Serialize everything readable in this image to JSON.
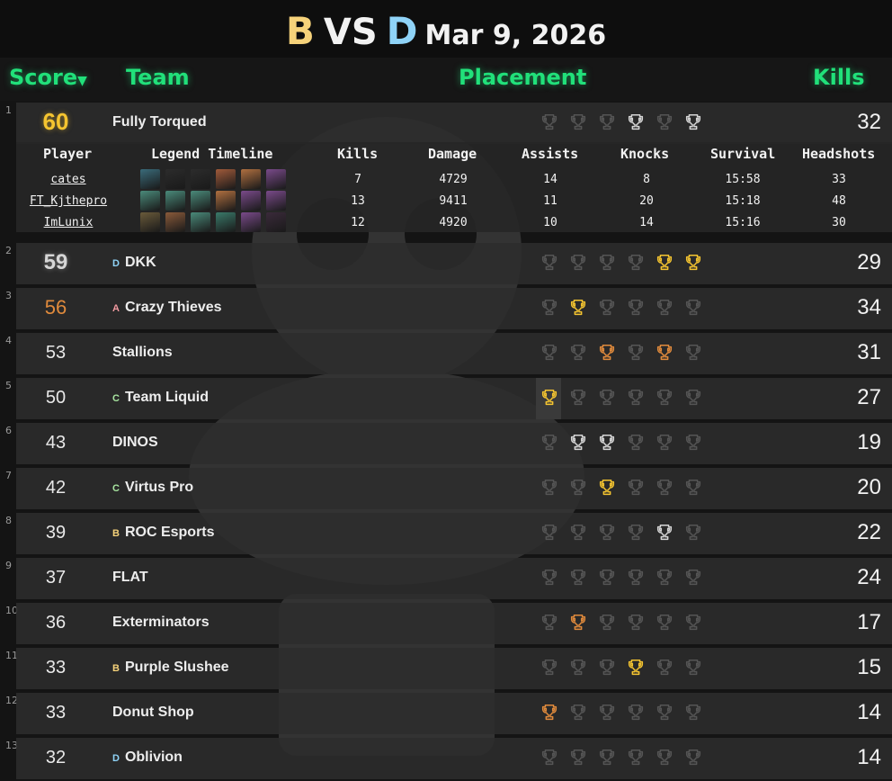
{
  "title": {
    "team_a": "B",
    "vs": "VS",
    "team_b": "D",
    "date": "Mar 9, 2026"
  },
  "header": {
    "score": "Score",
    "score_sort_icon": "caret-down-icon",
    "team": "Team",
    "placement": "Placement",
    "kills": "Kills"
  },
  "colors": {
    "accent": "#21e07a",
    "gold": "#f4c430",
    "silver": "#d6d6d6",
    "bronze": "#e08a3c",
    "trophy_dim": "#555555"
  },
  "details": {
    "headers": [
      "Player",
      "Legend Timeline",
      "Kills",
      "Damage",
      "Assists",
      "Knocks",
      "Survival",
      "Headshots"
    ],
    "players": [
      {
        "name": "cates",
        "kills": "7",
        "damage": "4729",
        "assists": "14",
        "knocks": "8",
        "survival": "15:58",
        "headshots": "33"
      },
      {
        "name": "FT_Kjthepro",
        "kills": "13",
        "damage": "9411",
        "assists": "11",
        "knocks": "20",
        "survival": "15:18",
        "headshots": "48"
      },
      {
        "name": "ImLunix",
        "kills": "12",
        "damage": "4920",
        "assists": "10",
        "knocks": "14",
        "survival": "15:16",
        "headshots": "30"
      }
    ]
  },
  "rows": [
    {
      "rank": "1",
      "score": "60",
      "group": "",
      "team": "Fully Torqued",
      "kills": "32",
      "placements": [
        "dim",
        "dim",
        "dim",
        "silver",
        "dim",
        "silver"
      ]
    },
    {
      "rank": "2",
      "score": "59",
      "group": "D",
      "team": "DKK",
      "kills": "29",
      "placements": [
        "dim",
        "dim",
        "dim",
        "dim",
        "gold",
        "gold"
      ]
    },
    {
      "rank": "3",
      "score": "56",
      "group": "A",
      "team": "Crazy Thieves",
      "kills": "34",
      "placements": [
        "dim",
        "gold",
        "dim",
        "dim",
        "dim",
        "dim"
      ]
    },
    {
      "rank": "4",
      "score": "53",
      "group": "",
      "team": "Stallions",
      "kills": "31",
      "placements": [
        "dim",
        "dim",
        "bronze",
        "dim",
        "bronze",
        "dim"
      ]
    },
    {
      "rank": "5",
      "score": "50",
      "group": "C",
      "team": "Team Liquid",
      "kills": "27",
      "placements": [
        "win",
        "dim",
        "dim",
        "dim",
        "dim",
        "dim"
      ]
    },
    {
      "rank": "6",
      "score": "43",
      "group": "",
      "team": "DINOS",
      "kills": "19",
      "placements": [
        "dim",
        "silver",
        "silver",
        "dim",
        "dim",
        "dim"
      ]
    },
    {
      "rank": "7",
      "score": "42",
      "group": "C",
      "team": "Virtus Pro",
      "kills": "20",
      "placements": [
        "dim",
        "dim",
        "gold",
        "dim",
        "dim",
        "dim"
      ]
    },
    {
      "rank": "8",
      "score": "39",
      "group": "B",
      "team": "ROC Esports",
      "kills": "22",
      "placements": [
        "dim",
        "dim",
        "dim",
        "dim",
        "silver",
        "dim"
      ]
    },
    {
      "rank": "9",
      "score": "37",
      "group": "",
      "team": "FLAT",
      "kills": "24",
      "placements": [
        "dim",
        "dim",
        "dim",
        "dim",
        "dim",
        "dim"
      ]
    },
    {
      "rank": "10",
      "score": "36",
      "group": "",
      "team": "Exterminators",
      "kills": "17",
      "placements": [
        "dim",
        "bronze",
        "dim",
        "dim",
        "dim",
        "dim"
      ]
    },
    {
      "rank": "11",
      "score": "33",
      "group": "B",
      "team": "Purple Slushee",
      "kills": "15",
      "placements": [
        "dim",
        "dim",
        "dim",
        "gold",
        "dim",
        "dim"
      ]
    },
    {
      "rank": "12",
      "score": "33",
      "group": "",
      "team": "Donut Shop",
      "kills": "14",
      "placements": [
        "bronze",
        "dim",
        "dim",
        "dim",
        "dim",
        "dim"
      ]
    },
    {
      "rank": "13",
      "score": "32",
      "group": "D",
      "team": "Oblivion",
      "kills": "14",
      "placements": [
        "dim",
        "dim",
        "dim",
        "dim",
        "dim",
        "dim"
      ]
    }
  ]
}
